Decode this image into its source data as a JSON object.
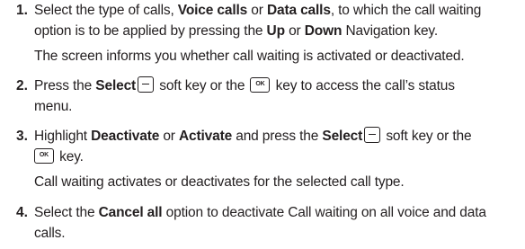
{
  "steps": [
    {
      "number": "1.",
      "lines": {
        "l1_a": "Select the type of calls, ",
        "l1_b": "Voice calls",
        "l1_c": " or ",
        "l1_d": "Data calls",
        "l1_e": ", to which the call waiting",
        "l2_a": "option is to be applied by pressing the ",
        "l2_b": "Up",
        "l2_c": " or ",
        "l2_d": "Down",
        "l2_e": " Navigation key.",
        "note": "The screen informs you whether call waiting is activated or deactivated."
      }
    },
    {
      "number": "2.",
      "lines": {
        "l1_a": "Press the ",
        "l1_b": "Select",
        "l1_c": " soft key or the ",
        "l1_d": " key to access the call’s status",
        "l2_a": "menu."
      }
    },
    {
      "number": "3.",
      "lines": {
        "l1_a": "Highlight ",
        "l1_b": "Deactivate",
        "l1_c": " or ",
        "l1_d": "Activate",
        "l1_e": " and press the ",
        "l1_f": "Select",
        "l1_g": " soft key or the",
        "l2_a": " key.",
        "note": "Call waiting activates or deactivates for the selected call type."
      }
    },
    {
      "number": "4.",
      "lines": {
        "l1_a": "Select the ",
        "l1_b": "Cancel all",
        "l1_c": " option to deactivate Call waiting on all voice and data",
        "l2_a": "calls."
      }
    }
  ],
  "icons": {
    "soft_key": "left-soft-key-icon",
    "ok_key": "ok-key-icon",
    "ok_key_label": "OK"
  }
}
